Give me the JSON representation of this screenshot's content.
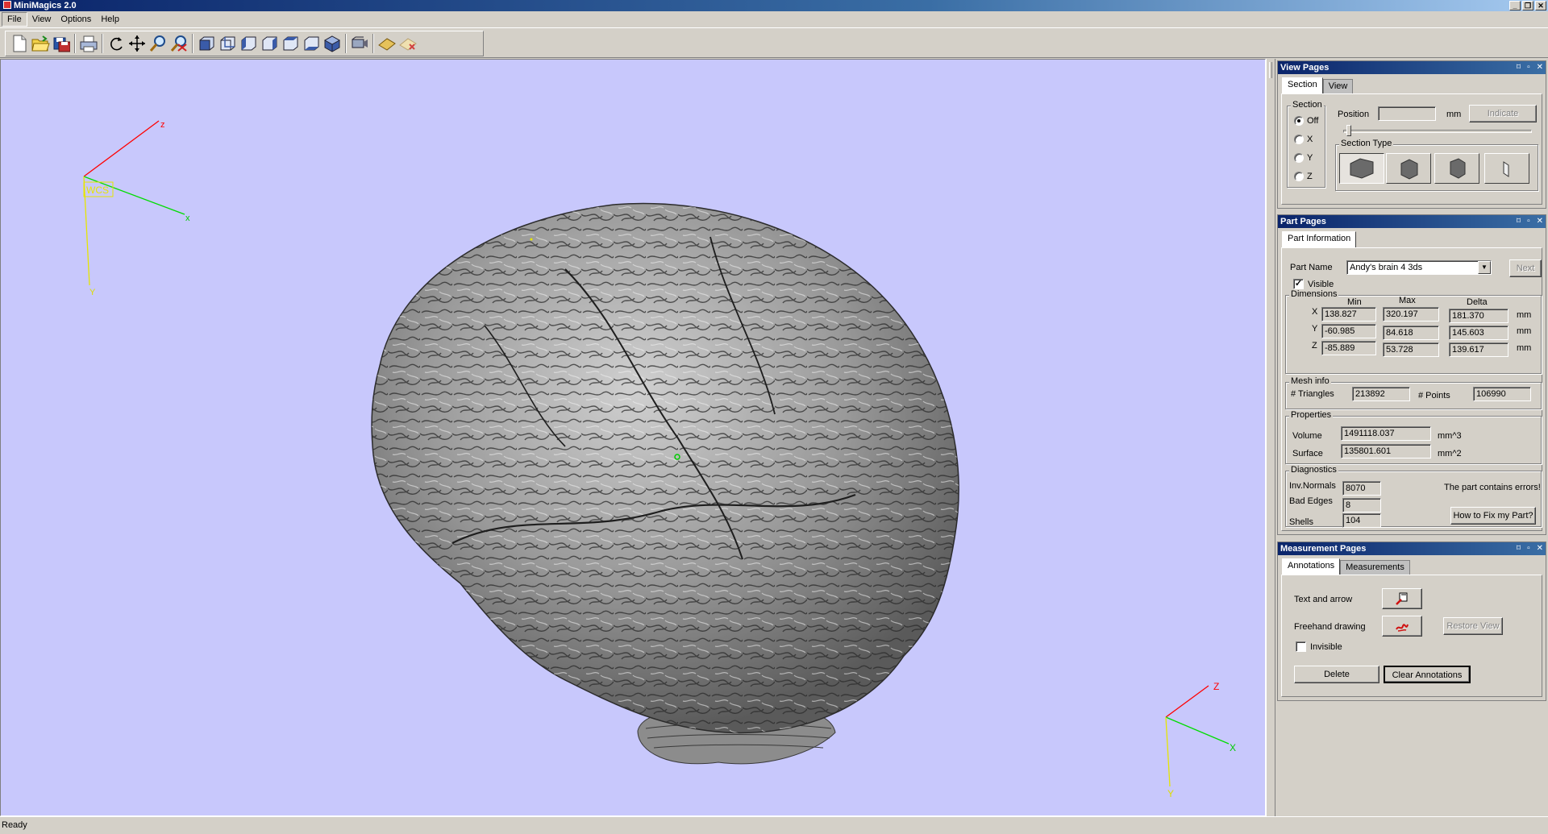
{
  "app": {
    "title": "MiniMagics 2.0"
  },
  "window_buttons": {
    "minimize": "_",
    "restore": "❐",
    "close": "✕"
  },
  "menu": [
    "File",
    "View",
    "Options",
    "Help"
  ],
  "toolbar_icons": [
    "new-file-icon",
    "open-folder-icon",
    "save-icon",
    "print-icon",
    "rotate-icon",
    "pan-icon",
    "zoom-icon",
    "zoom-window-icon",
    "view-front-icon",
    "view-back-icon",
    "view-left-icon",
    "view-right-icon",
    "view-top-icon",
    "view-bottom-icon",
    "view-iso-icon",
    "view-perspective-icon",
    "add-annotation-icon",
    "remove-annotation-icon"
  ],
  "viewport": {
    "background": "#c8c8fc",
    "model": "brain-mesh",
    "axes_main": {
      "x": "x",
      "y": "Y",
      "z": "z",
      "origin_label": "WCS"
    },
    "axes_corner": {
      "x": "X",
      "y": "Y",
      "z": "Z"
    }
  },
  "status": {
    "text": "Ready"
  },
  "view_pages": {
    "title": "View Pages",
    "panel_buttons": {
      "pin": "⌑",
      "menu": "▫",
      "close": "✕"
    },
    "tabs": [
      "Section",
      "View"
    ],
    "section_group": "Section",
    "section_options": [
      "Off",
      "X",
      "Y",
      "Z"
    ],
    "section_selected": "Off",
    "position_label": "Position",
    "position_unit": "mm",
    "indicate_button": "Indicate",
    "section_type_label": "Section Type"
  },
  "part_pages": {
    "title": "Part Pages",
    "tab": "Part Information",
    "part_name_label": "Part Name",
    "part_name": "Andy's brain 4 3ds",
    "next_button": "Next",
    "visible_label": "Visible",
    "visible_checked": true,
    "dimensions": {
      "label": "Dimensions",
      "headers": [
        "Min",
        "Max",
        "Delta"
      ],
      "rows": [
        {
          "axis": "X",
          "min": "138.827",
          "max": "320.197",
          "delta": "181.370",
          "unit": "mm"
        },
        {
          "axis": "Y",
          "min": "-60.985",
          "max": "84.618",
          "delta": "145.603",
          "unit": "mm"
        },
        {
          "axis": "Z",
          "min": "-85.889",
          "max": "53.728",
          "delta": "139.617",
          "unit": "mm"
        }
      ]
    },
    "mesh": {
      "label": "Mesh info",
      "triangles_label": "# Triangles",
      "triangles": "213892",
      "points_label": "# Points",
      "points": "106990"
    },
    "properties": {
      "label": "Properties",
      "volume_label": "Volume",
      "volume": "1491118.037",
      "volume_unit": "mm^3",
      "surface_label": "Surface",
      "surface": "135801.601",
      "surface_unit": "mm^2"
    },
    "diagnostics": {
      "label": "Diagnostics",
      "inv_normals_label": "Inv.Normals",
      "inv_normals": "8070",
      "bad_edges_label": "Bad Edges",
      "bad_edges": "8",
      "shells_label": "Shells",
      "shells": "104",
      "message": "The part contains errors!",
      "fix_button": "How to Fix my Part?"
    }
  },
  "measurement_pages": {
    "title": "Measurement Pages",
    "tabs": [
      "Annotations",
      "Measurements"
    ],
    "text_arrow_label": "Text and arrow",
    "freehand_label": "Freehand drawing",
    "restore_view_button": "Restore View",
    "invisible_label": "Invisible",
    "invisible_checked": false,
    "delete_button": "Delete",
    "clear_button": "Clear Annotations"
  }
}
